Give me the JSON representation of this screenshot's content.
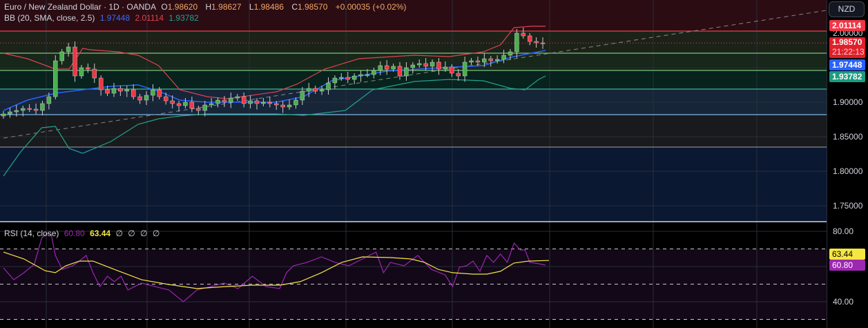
{
  "header": {
    "symbol": "Euro / New Zealand Dollar · 1D · OANDA",
    "o_label": "O",
    "o": "1.98620",
    "h_label": "H",
    "h": "1.98627",
    "l_label": "L",
    "l": "1.98486",
    "c_label": "C",
    "c": "1.98570",
    "change": "+0.00035 (+0.02%)"
  },
  "bb": {
    "label": "BB (20, SMA, close, 2.5)",
    "basis": "1.97448",
    "upper": "2.01114",
    "lower": "1.93782"
  },
  "rsi": {
    "label": "RSI (14, close)",
    "value": "60.80",
    "ma": "63.44",
    "extra": [
      "∅",
      "∅",
      "∅",
      "∅"
    ]
  },
  "currency_button": "NZD",
  "price_axis": {
    "ticks": [
      "2.00000",
      "1.90000",
      "1.85000",
      "1.80000",
      "1.75000"
    ],
    "tick_values": [
      2.0,
      1.9,
      1.85,
      1.8,
      1.75
    ],
    "badges": {
      "upper": "2.01114",
      "price": "1.98570",
      "countdown": "21:22:13",
      "basis": "1.97448",
      "lower": "1.93782"
    }
  },
  "rsi_axis": {
    "ticks": [
      "80.00",
      "40.00"
    ],
    "tick_values": [
      80,
      40
    ],
    "badges": {
      "ma": "63.44",
      "rsi": "60.80"
    }
  },
  "colors": {
    "up": "#4caf50",
    "down": "#f23645",
    "upper": "#e0424f",
    "basis": "#2962ff",
    "lower": "#22a48a",
    "rsi": "#9c27b0",
    "rsi_ma": "#f5e642"
  },
  "chart_data": {
    "type": "candlestick",
    "price_range": [
      1.72,
      2.048
    ],
    "first_open": 1.88,
    "closes": [
      1.883,
      1.886,
      1.888,
      1.891,
      1.89,
      1.888,
      1.898,
      1.908,
      1.96,
      1.973,
      1.98,
      1.938,
      1.95,
      1.948,
      1.935,
      1.918,
      1.913,
      1.92,
      1.916,
      1.918,
      1.908,
      1.903,
      1.91,
      1.918,
      1.908,
      1.902,
      1.898,
      1.895,
      1.9,
      1.891,
      1.888,
      1.896,
      1.898,
      1.903,
      1.9,
      1.906,
      1.908,
      1.898,
      1.902,
      1.898,
      1.9,
      1.898,
      1.896,
      1.893,
      1.896,
      1.903,
      1.916,
      1.92,
      1.916,
      1.918,
      1.928,
      1.935,
      1.936,
      1.933,
      1.938,
      1.94,
      1.94,
      1.946,
      1.953,
      1.948,
      1.952,
      1.938,
      1.95,
      1.954,
      1.956,
      1.952,
      1.958,
      1.948,
      1.951,
      1.942,
      1.938,
      1.958,
      1.96,
      1.958,
      1.963,
      1.96,
      1.962,
      1.968,
      1.973,
      2.0,
      1.996,
      1.988,
      1.986,
      1.9857
    ],
    "levels": [
      2.003,
      1.971,
      1.946,
      1.919,
      1.882,
      1.835
    ],
    "trendline": [
      [
        0,
        1.848
      ],
      [
        120.4,
        2.033
      ]
    ],
    "bb_upper": [
      [
        0,
        1.971
      ],
      [
        3.5,
        1.963
      ],
      [
        7.6,
        1.948
      ],
      [
        9.6,
        1.948
      ],
      [
        11.6,
        1.978
      ],
      [
        12.6,
        1.976
      ],
      [
        16.7,
        1.973
      ],
      [
        19.7,
        1.968
      ],
      [
        22.7,
        1.953
      ],
      [
        25.8,
        1.918
      ],
      [
        29.8,
        1.908
      ],
      [
        32.8,
        1.905
      ],
      [
        39.9,
        1.915
      ],
      [
        42.9,
        1.926
      ],
      [
        47,
        1.948
      ],
      [
        52,
        1.963
      ],
      [
        60.1,
        1.968
      ],
      [
        65.2,
        1.966
      ],
      [
        70.2,
        1.973
      ],
      [
        72.7,
        1.983
      ],
      [
        74.7,
        2.008
      ],
      [
        77.3,
        2.01
      ],
      [
        79.3,
        2.01
      ]
    ],
    "bb_basis": [
      [
        0,
        1.888
      ],
      [
        3.5,
        1.903
      ],
      [
        7.6,
        1.913
      ],
      [
        11.6,
        1.918
      ],
      [
        15.7,
        1.923
      ],
      [
        19.7,
        1.925
      ],
      [
        22.7,
        1.916
      ],
      [
        25.8,
        1.903
      ],
      [
        29.8,
        1.9
      ],
      [
        39.9,
        1.9
      ],
      [
        43.9,
        1.908
      ],
      [
        48,
        1.931
      ],
      [
        52,
        1.938
      ],
      [
        56.1,
        1.945
      ],
      [
        64.1,
        1.95
      ],
      [
        70.2,
        1.953
      ],
      [
        74.2,
        1.965
      ],
      [
        79.3,
        1.975
      ]
    ],
    "bb_lower": [
      [
        0,
        1.793
      ],
      [
        2.5,
        1.828
      ],
      [
        5.6,
        1.863
      ],
      [
        7.6,
        1.865
      ],
      [
        9.6,
        1.833
      ],
      [
        11.6,
        1.826
      ],
      [
        15.7,
        1.843
      ],
      [
        19.7,
        1.868
      ],
      [
        22.7,
        1.876
      ],
      [
        25.8,
        1.88
      ],
      [
        29.8,
        1.883
      ],
      [
        39.9,
        1.883
      ],
      [
        43.9,
        1.881
      ],
      [
        50,
        1.888
      ],
      [
        54,
        1.918
      ],
      [
        60.1,
        1.93
      ],
      [
        65.2,
        1.933
      ],
      [
        70.2,
        1.931
      ],
      [
        74.2,
        1.92
      ],
      [
        76.3,
        1.918
      ],
      [
        78.3,
        1.933
      ],
      [
        79.3,
        1.938
      ]
    ],
    "rsi_range": [
      85.5,
      25
    ],
    "rsi_levels": [
      70,
      50,
      30
    ],
    "rsi": [
      [
        0,
        59.2
      ],
      [
        1.5,
        52.5
      ],
      [
        3,
        56.5
      ],
      [
        4.5,
        61.2
      ],
      [
        5.6,
        76.1
      ],
      [
        6.3,
        78.8
      ],
      [
        7,
        78
      ],
      [
        7.6,
        66.3
      ],
      [
        8.6,
        58.4
      ],
      [
        10.1,
        60.4
      ],
      [
        11.1,
        63.1
      ],
      [
        12.1,
        66.3
      ],
      [
        13.1,
        56.5
      ],
      [
        14.1,
        48.6
      ],
      [
        15.2,
        54.5
      ],
      [
        16.2,
        51.4
      ],
      [
        17.2,
        54.5
      ],
      [
        18.2,
        46.7
      ],
      [
        20.2,
        50.6
      ],
      [
        22.2,
        48.6
      ],
      [
        24.2,
        46.7
      ],
      [
        26.3,
        40
      ],
      [
        28.3,
        46.7
      ],
      [
        30.3,
        48.6
      ],
      [
        32.3,
        50.6
      ],
      [
        34.3,
        47.5
      ],
      [
        36.4,
        54.5
      ],
      [
        38.4,
        48.6
      ],
      [
        40.4,
        47.5
      ],
      [
        41.4,
        56.5
      ],
      [
        42.4,
        60.4
      ],
      [
        44.4,
        62.4
      ],
      [
        46.5,
        65.5
      ],
      [
        48.5,
        62.4
      ],
      [
        50.5,
        60.4
      ],
      [
        52.5,
        64.3
      ],
      [
        54.5,
        68.2
      ],
      [
        55.6,
        56.5
      ],
      [
        56.6,
        62.4
      ],
      [
        58.6,
        60.4
      ],
      [
        60.6,
        66.3
      ],
      [
        62.6,
        58.4
      ],
      [
        64.6,
        55.3
      ],
      [
        65.7,
        48.6
      ],
      [
        66.7,
        59.6
      ],
      [
        67.7,
        60.4
      ],
      [
        68.7,
        63.1
      ],
      [
        69.7,
        57.3
      ],
      [
        70.7,
        66.3
      ],
      [
        71.7,
        62.4
      ],
      [
        72.7,
        67.1
      ],
      [
        73.7,
        62.4
      ],
      [
        74.7,
        73.3
      ],
      [
        75.6,
        69.4
      ],
      [
        76.3,
        69.4
      ],
      [
        77,
        62.4
      ],
      [
        78.3,
        61.6
      ],
      [
        79.3,
        60.8
      ]
    ],
    "rsi_ma": [
      [
        0,
        68.2
      ],
      [
        3,
        64.3
      ],
      [
        6.1,
        57.6
      ],
      [
        7.6,
        56.5
      ],
      [
        9.1,
        60.4
      ],
      [
        11.1,
        63.1
      ],
      [
        13.1,
        63.1
      ],
      [
        16.2,
        58.4
      ],
      [
        20.2,
        52.5
      ],
      [
        24.2,
        49.8
      ],
      [
        28.3,
        47.5
      ],
      [
        32.3,
        48.6
      ],
      [
        36.4,
        49.4
      ],
      [
        40.4,
        49.4
      ],
      [
        43.4,
        51.4
      ],
      [
        46.5,
        56.5
      ],
      [
        49.5,
        62.4
      ],
      [
        52.5,
        65.5
      ],
      [
        56.6,
        65.1
      ],
      [
        59.6,
        64.3
      ],
      [
        61.6,
        62.4
      ],
      [
        63.6,
        58.4
      ],
      [
        65.7,
        56.5
      ],
      [
        68.7,
        55.7
      ],
      [
        70.7,
        55.7
      ],
      [
        72.7,
        57.3
      ],
      [
        74.7,
        62
      ],
      [
        76.8,
        63.1
      ],
      [
        79.8,
        63.44
      ]
    ]
  }
}
